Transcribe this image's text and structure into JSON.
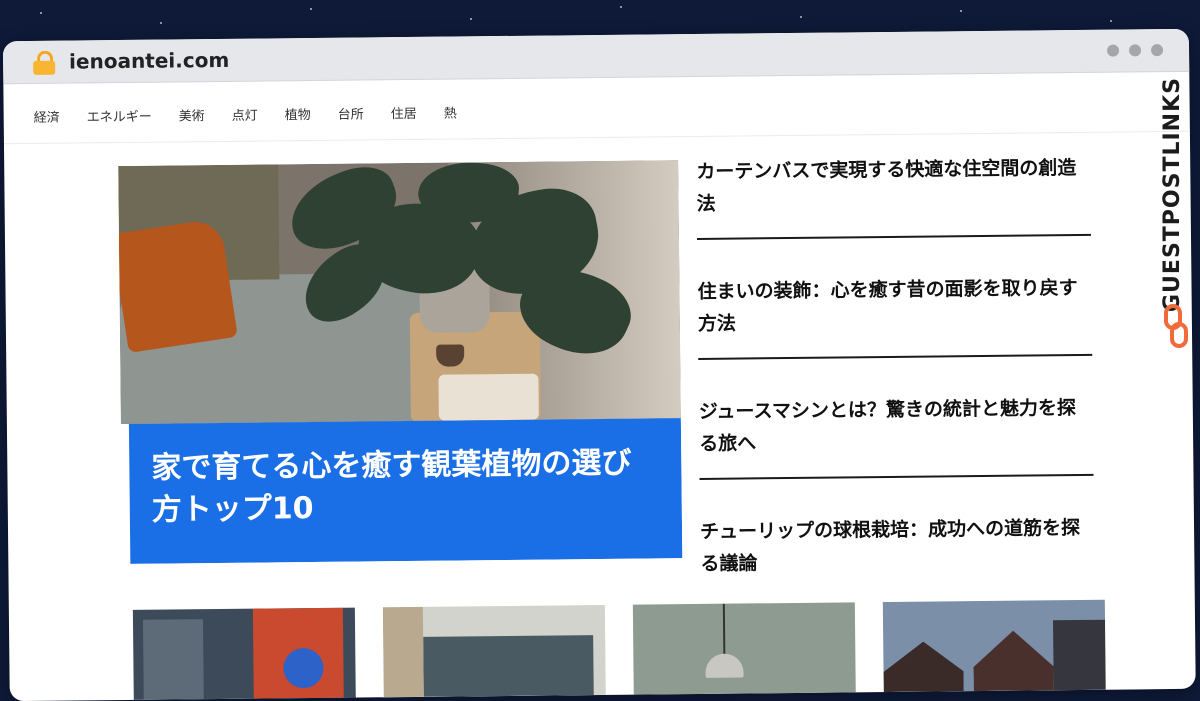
{
  "browser": {
    "url": "ienoantei.com",
    "icons": {
      "lock": "lock-icon",
      "window_controls": "window-dots-icon"
    }
  },
  "nav": {
    "items": [
      "経済",
      "エネルギー",
      "美術",
      "点灯",
      "植物",
      "台所",
      "住居",
      "熱"
    ]
  },
  "hero": {
    "title": "家で育てる心を癒す観葉植物の選び方トップ10",
    "caption_color": "#1b6fe6"
  },
  "side_stories": [
    {
      "title": "カーテンバスで実現する快適な住空間の創造法"
    },
    {
      "title": "住まいの装飾：心を癒す昔の面影を取り戻す方法"
    },
    {
      "title": "ジュースマシンとは？驚きの統計と魅力を探る旅へ"
    },
    {
      "title": "チューリップの球根栽培：成功への道筋を探る議論"
    }
  ],
  "thumbnails": [
    "thumbnail-1",
    "thumbnail-2",
    "thumbnail-3",
    "thumbnail-4"
  ],
  "watermark": {
    "text": "GUESTPOSTLINKS",
    "accent": "#f06a3a"
  }
}
